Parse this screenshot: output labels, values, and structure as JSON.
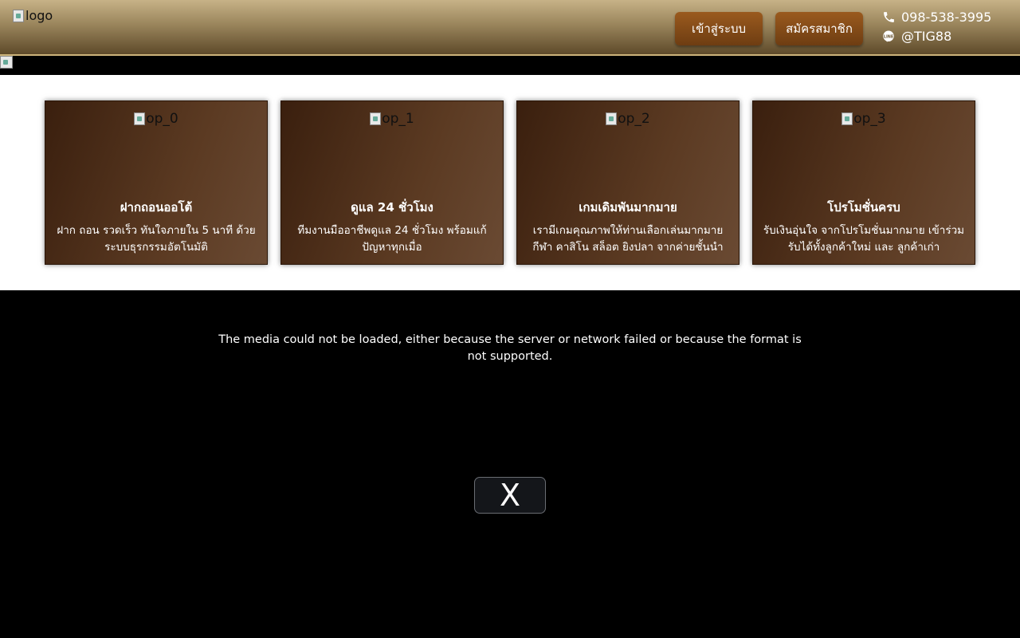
{
  "header": {
    "logo_alt": "logo",
    "login_label": "เข้าสู่ระบบ",
    "register_label": "สมัครสมาชิก",
    "phone": "098-538-3995",
    "line_id": "@TIG88",
    "icons": {
      "phone": "phone-icon",
      "line": "line-icon"
    }
  },
  "features": [
    {
      "img_alt": "op_0",
      "title": "ฝากถอนออโต้",
      "desc": "ฝาก ถอน รวดเร็ว ทันใจภายใน 5 นาที ด้วยระบบธุรกรรมอัตโนมัติ"
    },
    {
      "img_alt": "op_1",
      "title": "ดูแล 24 ชั่วโมง",
      "desc": "ทีมงานมืออาชีพดูแล 24 ชั่วโมง พร้อมแก้ปัญหาทุกเมื่อ"
    },
    {
      "img_alt": "op_2",
      "title": "เกมเดิมพันมากมาย",
      "desc": "เรามีเกมคุณภาพให้ท่านเลือกเล่นมากมาย กีฬา คาสิโน สล็อต ยิงปลา จากค่ายชั้นนำ"
    },
    {
      "img_alt": "op_3",
      "title": "โปรโมชั่นครบ",
      "desc": "รับเงินอุ่นใจ จากโปรโมชั่นมากมาย เข้าร่วมรับได้ทั้งลูกค้าใหม่ และ ลูกค้าเก่า"
    }
  ],
  "media": {
    "error_text": "The media could not be loaded, either because the server or network failed or because the format is not supported.",
    "close_label": "X"
  },
  "colors": {
    "header_gold": "#c7b287",
    "button_brown": "#8a4f1a",
    "card_brown": "#4a2c17"
  }
}
